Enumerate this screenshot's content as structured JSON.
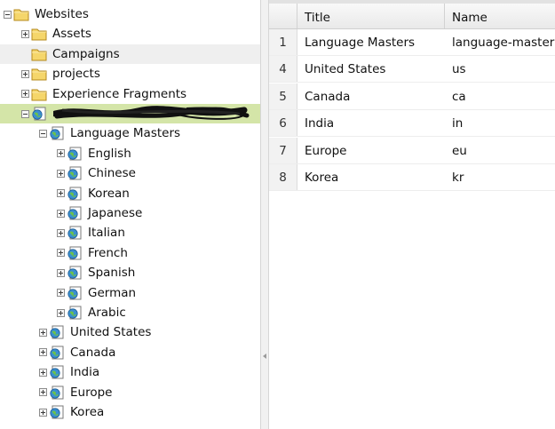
{
  "tree": {
    "nodes": [
      {
        "label": "Websites",
        "icon": "folder-icon",
        "toggle": "minus",
        "state": "",
        "key": "websites"
      },
      {
        "label": "Assets",
        "icon": "folder-icon",
        "toggle": "plus",
        "state": "",
        "key": "assets"
      },
      {
        "label": "Campaigns",
        "icon": "folder-icon",
        "toggle": "none",
        "state": "hover",
        "key": "campaigns"
      },
      {
        "label": "projects",
        "icon": "folder-icon",
        "toggle": "plus",
        "state": "",
        "key": "projects"
      },
      {
        "label": "Experience Fragments",
        "icon": "folder-icon",
        "toggle": "plus",
        "state": "",
        "key": "experience-fragments"
      },
      {
        "label": "",
        "icon": "page-icon",
        "toggle": "minus",
        "state": "selected",
        "key": "redacted-site"
      },
      {
        "label": "Language Masters",
        "icon": "page-icon",
        "toggle": "minus",
        "state": "",
        "key": "language-masters"
      },
      {
        "label": "English",
        "icon": "page-icon",
        "toggle": "plus",
        "state": "",
        "key": "english"
      },
      {
        "label": "Chinese",
        "icon": "page-icon",
        "toggle": "plus",
        "state": "",
        "key": "chinese"
      },
      {
        "label": "Korean",
        "icon": "page-icon",
        "toggle": "plus",
        "state": "",
        "key": "korean"
      },
      {
        "label": "Japanese",
        "icon": "page-icon",
        "toggle": "plus",
        "state": "",
        "key": "japanese"
      },
      {
        "label": "Italian",
        "icon": "page-icon",
        "toggle": "plus",
        "state": "",
        "key": "italian"
      },
      {
        "label": "French",
        "icon": "page-icon",
        "toggle": "plus",
        "state": "",
        "key": "french"
      },
      {
        "label": "Spanish",
        "icon": "page-icon",
        "toggle": "plus",
        "state": "",
        "key": "spanish"
      },
      {
        "label": "German",
        "icon": "page-icon",
        "toggle": "plus",
        "state": "",
        "key": "german"
      },
      {
        "label": "Arabic",
        "icon": "page-icon",
        "toggle": "plus",
        "state": "",
        "key": "arabic"
      },
      {
        "label": "United States",
        "icon": "page-icon",
        "toggle": "plus",
        "state": "",
        "key": "united-states"
      },
      {
        "label": "Canada",
        "icon": "page-icon",
        "toggle": "plus",
        "state": "",
        "key": "canada"
      },
      {
        "label": "India",
        "icon": "page-icon",
        "toggle": "plus",
        "state": "",
        "key": "india"
      },
      {
        "label": "Europe",
        "icon": "page-icon",
        "toggle": "plus",
        "state": "",
        "key": "europe"
      },
      {
        "label": "Korea",
        "icon": "page-icon",
        "toggle": "plus",
        "state": "",
        "key": "korea"
      }
    ]
  },
  "grid": {
    "columns": [
      "Title",
      "Name"
    ],
    "rows": [
      {
        "num": "1",
        "title": "Language Masters",
        "name": "language-masters"
      },
      {
        "num": "4",
        "title": "United States",
        "name": "us"
      },
      {
        "num": "5",
        "title": "Canada",
        "name": "ca"
      },
      {
        "num": "6",
        "title": "India",
        "name": "in"
      },
      {
        "num": "7",
        "title": "Europe",
        "name": "eu"
      },
      {
        "num": "8",
        "title": "Korea",
        "name": "kr"
      }
    ]
  },
  "colors": {
    "selected_row": "#d4e5a8",
    "hover_row": "#efefef",
    "folder_fill": "#f5d66b",
    "globe_fill": "#3a8fd0"
  }
}
